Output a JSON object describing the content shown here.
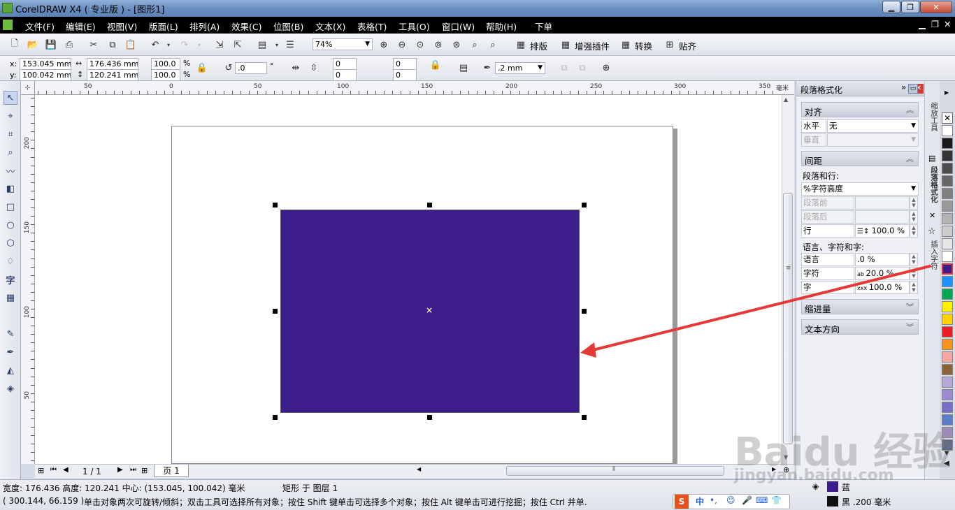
{
  "window": {
    "title": "CorelDRAW X4 ( 专业版 ) - [图形1]"
  },
  "menu": {
    "items": [
      "文件(F)",
      "编辑(E)",
      "视图(V)",
      "版面(L)",
      "排列(A)",
      "效果(C)",
      "位图(B)",
      "文本(X)",
      "表格(T)",
      "工具(O)",
      "窗口(W)",
      "帮助(H)",
      "下单"
    ]
  },
  "toolbar": {
    "zoom": "74%",
    "buttons": [
      "排版",
      "增强插件",
      "转换",
      "贴齐"
    ]
  },
  "properties": {
    "x": "153.045 mm",
    "y": "100.042 mm",
    "width": "176.436 mm",
    "height": "120.241 mm",
    "scale_x": "100.0",
    "scale_y": "100.0",
    "percent": "%",
    "rotation": ".0",
    "degree": "°",
    "corner1": "0",
    "corner2": "0",
    "corner3": "0",
    "corner4": "0",
    "outline": ".2 mm"
  },
  "ruler": {
    "h_labels": [
      "50",
      "0",
      "50",
      "100",
      "150",
      "200",
      "250",
      "300",
      "350"
    ],
    "unit": "毫米",
    "v_labels": [
      "200",
      "150",
      "100",
      "50"
    ]
  },
  "nav": {
    "page_counter": "1 / 1",
    "page_tab": "页 1"
  },
  "status": {
    "dimensions": "宽度: 176.436  高度: 120.241  中心: (153.045, 100.042)  毫米",
    "object": "矩形 于 图层 1",
    "coords": "( 300.144, 66.159 )",
    "hint": "单击对象两次可旋转/倾斜；双击工具可选择所有对象；按住 Shift 键单击可选择多个对象；按住 Alt 键单击可进行挖掘；按住 Ctrl 并单...",
    "fill_name": "蓝",
    "outline_name": "黑 .200 毫米",
    "fill_color": "#3d1c8c",
    "outline_color": "#111111"
  },
  "docker": {
    "title": "段落格式化",
    "align": {
      "header": "对齐",
      "horizontal_label": "水平",
      "horizontal_value": "无",
      "vertical_label": "垂直"
    },
    "spacing": {
      "header": "间距",
      "para_line_label": "段落和行:",
      "mode": "%字符高度",
      "before_label": "段落前",
      "after_label": "段落后",
      "line_label": "行",
      "line_value": "100.0 %",
      "lang_char_label": "语言、字符和字:",
      "lang_label": "语言",
      "lang_value": ".0 %",
      "char_label": "字符",
      "char_value": "20.0 %",
      "word_label": "字",
      "word_value": "100.0 %"
    },
    "indent_header": "缩进量",
    "text_dir_header": "文本方向"
  },
  "side_tabs": [
    "缩放工具",
    "段落格式化",
    "插入字符"
  ],
  "palette": [
    "#ffffff",
    "#1a1a1a",
    "#333333",
    "#4d4d4d",
    "#666666",
    "#808080",
    "#999999",
    "#b3b3b3",
    "#cccccc",
    "#e6e6e6",
    "#ffffff",
    "#3d1c8c",
    "#1e90ff",
    "#00a651",
    "#fff200",
    "#ffd200",
    "#ed1c24",
    "#f7941d",
    "#f9a4a4",
    "#8c6239",
    "#b8a8d8",
    "#9b8ad0",
    "#7a6fc4",
    "#5a7fc8",
    "#9e8ab8",
    "#5f6a8a"
  ],
  "ime": {
    "label": "中"
  },
  "watermark": {
    "brand": "Baidu 经验",
    "url": "jingyan.baidu.com"
  }
}
